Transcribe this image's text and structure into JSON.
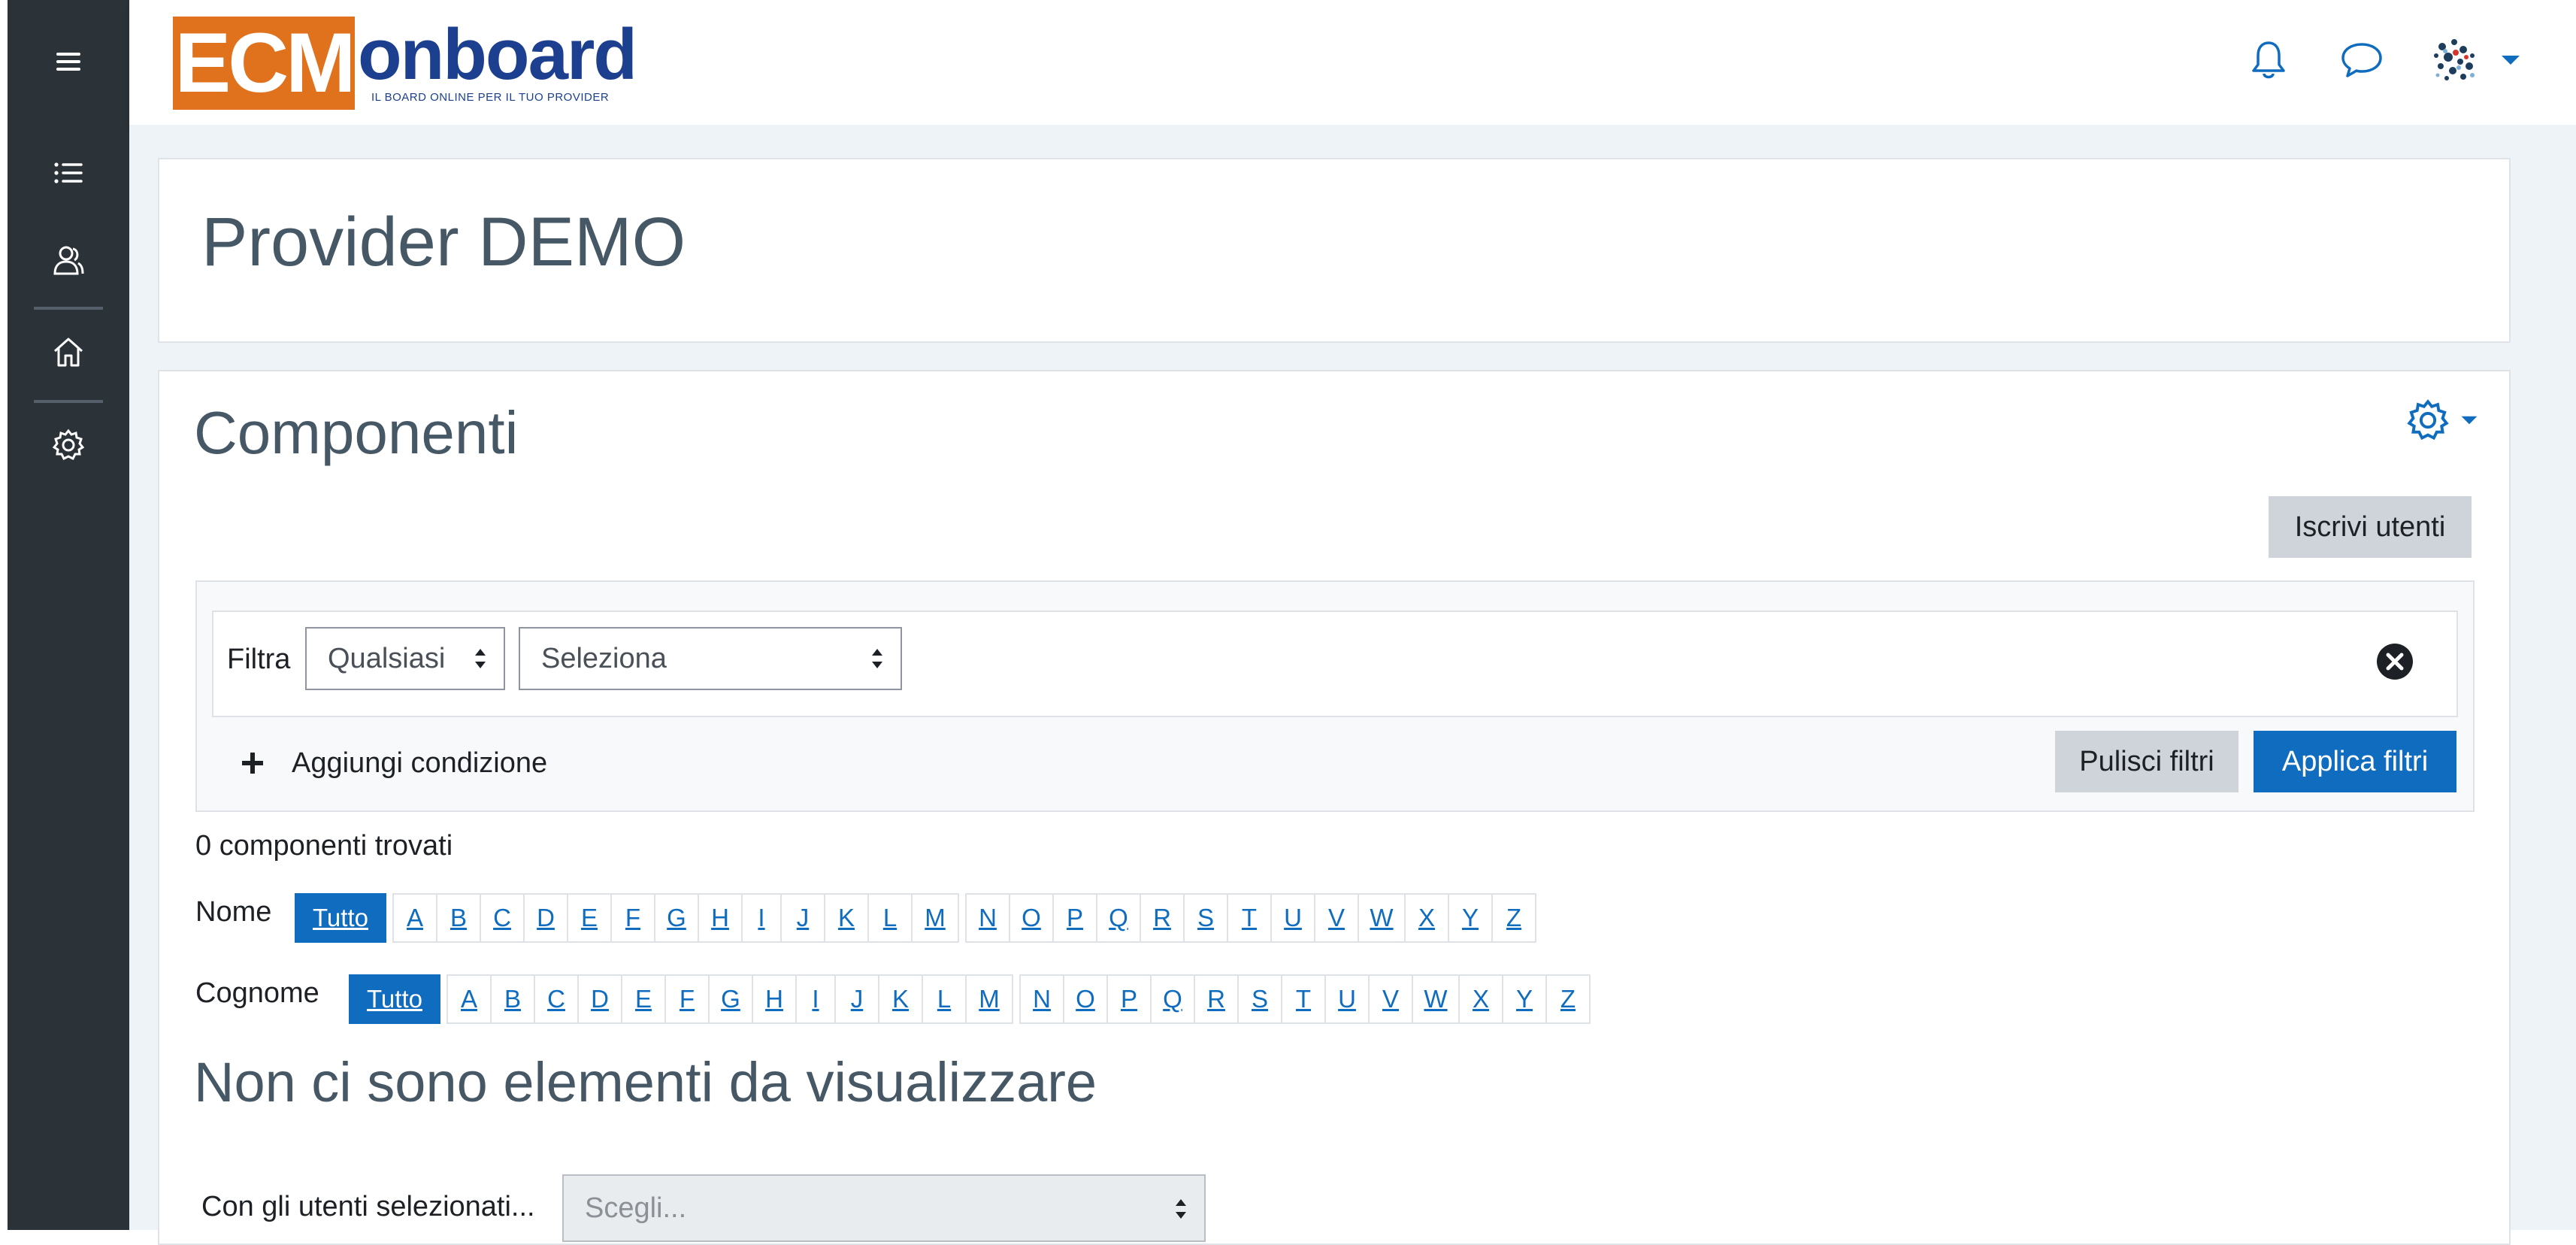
{
  "logo": {
    "part1": "ECM",
    "part2": "onboard",
    "tagline": "IL BOARD ONLINE PER IL TUO PROVIDER"
  },
  "page": {
    "title": "Provider DEMO"
  },
  "section": {
    "title": "Componenti"
  },
  "buttons": {
    "enrol": "Iscrivi utenti",
    "clear_filters": "Pulisci filtri",
    "apply_filters": "Applica filtri",
    "add_condition": "Aggiungi condizione"
  },
  "filter": {
    "label": "Filtra",
    "match_select": "Qualsiasi",
    "field_select": "Seleziona"
  },
  "results": {
    "count_text": "0 componenti trovati",
    "empty_message": "Non ci sono elementi da visualizzare"
  },
  "initials": {
    "first_name_label": "Nome",
    "last_name_label": "Cognome",
    "all_label": "Tutto",
    "letters": [
      "A",
      "B",
      "C",
      "D",
      "E",
      "F",
      "G",
      "H",
      "I",
      "J",
      "K",
      "L",
      "M",
      "N",
      "O",
      "P",
      "Q",
      "R",
      "S",
      "T",
      "U",
      "V",
      "W",
      "X",
      "Y",
      "Z"
    ]
  },
  "bulk": {
    "label": "Con gli utenti selezionati...",
    "select_placeholder": "Scegli..."
  },
  "icons": {
    "sidebar": [
      "hamburger-icon",
      "list-icon",
      "participants-icon",
      "home-icon",
      "settings-gear-icon"
    ],
    "navbar": [
      "bell-icon",
      "chat-icon",
      "avatar"
    ]
  },
  "colors": {
    "primary": "#0f6cbf",
    "sidebar": "#2b3238",
    "logo_orange": "#e0711d",
    "logo_blue": "#1c3f8f"
  }
}
